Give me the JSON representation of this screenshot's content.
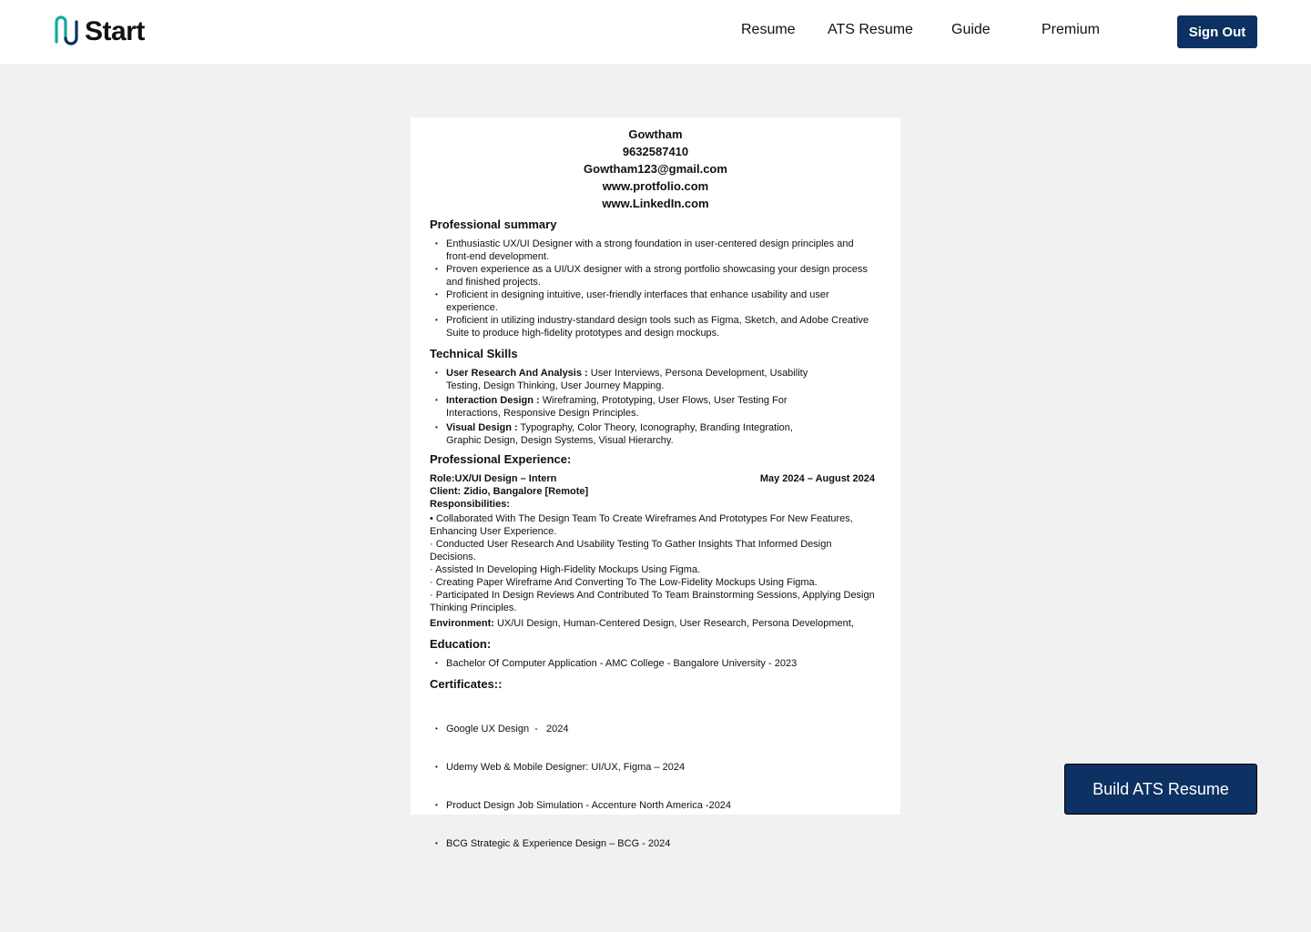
{
  "app": {
    "logo_text": "Start"
  },
  "nav": {
    "resume": "Resume",
    "ats_resume": "ATS Resume",
    "guide": "Guide",
    "premium": "Premium",
    "sign_out": "Sign Out"
  },
  "resume": {
    "name": "Gowtham",
    "phone": "9632587410",
    "email": "Gowtham123@gmail.com",
    "portfolio": "www.protfolio.com",
    "linkedin": "www.LinkedIn.com",
    "summary_title": "Professional summary",
    "summary": [
      "Enthusiastic UX/UI Designer with a strong foundation in user-centered design principles and front-end development.",
      "Proven experience as a UI/UX designer with a strong portfolio showcasing your design process and finished projects.",
      "Proficient in designing intuitive, user-friendly interfaces that enhance usability and user experience.",
      "Proficient in utilizing industry-standard design tools such as Figma, Sketch, and Adobe Creative Suite to produce high-fidelity prototypes and design mockups."
    ],
    "skills_title": "Technical Skills",
    "skills": [
      {
        "label": "User Research And Analysis :",
        "text": " User Interviews, Persona Development, Usability Testing, Design Thinking, User Journey Mapping."
      },
      {
        "label": "Interaction Design :",
        "text": " Wireframing, Prototyping, User Flows, User Testing For Interactions, Responsive Design Principles."
      },
      {
        "label": "Visual Design :",
        "text": " Typography, Color Theory, Iconography, Branding Integration, Graphic Design, Design Systems, Visual Hierarchy."
      }
    ],
    "experience_title": "Professional Experience:",
    "role": "Role:UX/UI Design – Intern",
    "dates": "May 2024 – August 2024",
    "client": "Client: Zidio, Bangalore [Remote]",
    "responsibilities_title": "Responsibilities:",
    "responsibilities": [
      "• Collaborated With The Design Team To Create Wireframes And Prototypes For New Features, Enhancing User Experience.",
      "· Conducted User Research And Usability Testing To Gather Insights That Informed Design Decisions.",
      "·  Assisted In Developing High-Fidelity Mockups Using Figma.",
      "·  Creating Paper Wireframe And Converting To The Low-Fidelity Mockups Using Figma.",
      "·  Participated In Design Reviews And Contributed To Team Brainstorming Sessions, Applying Design Thinking Principles."
    ],
    "environment_label": "Environment:",
    "environment": " UX/UI Design, Human-Centered Design, User Research, Persona Development,",
    "education_title": "Education:",
    "education": [
      "Bachelor Of Computer Application - AMC College - Bangalore University - 2023"
    ],
    "certificates_title": "Certificates::",
    "certificates": [
      "Google UX Design  -   2024",
      "Udemy Web & Mobile Designer: UI/UX, Figma – 2024",
      "Product Design Job Simulation - Accenture North America -2024",
      "BCG Strategic & Experience Design – BCG - 2024"
    ]
  },
  "actions": {
    "build_ats": "Build ATS Resume"
  },
  "colors": {
    "primary": "#0c3162",
    "logo_teal": "#14a89a",
    "logo_dark": "#0c3162",
    "background": "#f1f1f1"
  }
}
